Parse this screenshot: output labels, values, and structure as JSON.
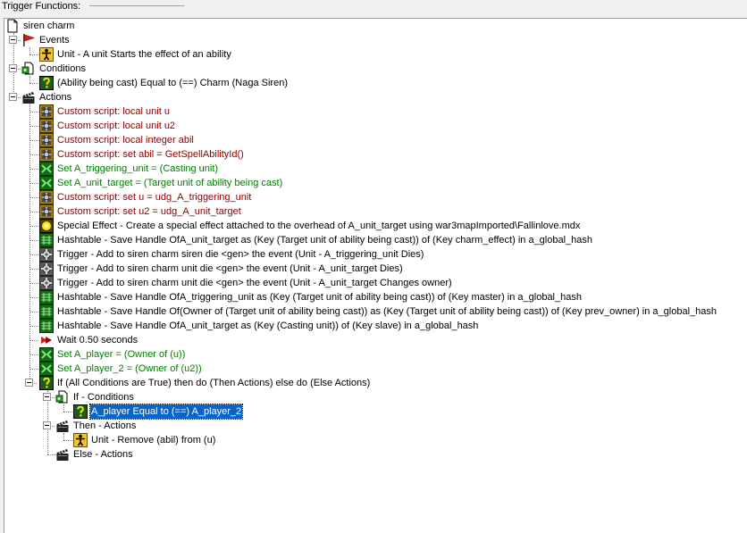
{
  "frame": {
    "title": "Trigger Functions:"
  },
  "colors": {
    "script_text": "#8b0000",
    "variable_text": "#008000",
    "selection_bg": "#0a64c8",
    "selection_text": "#ffffff"
  },
  "tree": {
    "root": {
      "label": "siren charm",
      "icon": "trigger-document-icon"
    },
    "events": {
      "label": "Events",
      "icon": "red-flag-icon",
      "items": [
        {
          "label": "Unit - A unit Starts the effect of an ability",
          "icon": "unit-figure-icon"
        }
      ]
    },
    "conditions": {
      "label": "Conditions",
      "icon": "conditions-icon",
      "items": [
        {
          "label": "(Ability being cast) Equal to (==) Charm (Naga Siren)",
          "icon": "question-mark-icon"
        }
      ]
    },
    "actions": {
      "label": "Actions",
      "icon": "clapperboard-icon",
      "items": [
        {
          "label": "Custom script:   local unit u",
          "icon": "custom-script-icon"
        },
        {
          "label": "Custom script:   local unit u2",
          "icon": "custom-script-icon"
        },
        {
          "label": "Custom script:   local integer abil",
          "icon": "custom-script-icon"
        },
        {
          "label": "Custom script:   set abil = GetSpellAbilityId()",
          "icon": "custom-script-icon"
        },
        {
          "label": "Set A_triggering_unit = (Casting unit)",
          "icon": "set-variable-icon"
        },
        {
          "label": "Set A_unit_target = (Target unit of ability being cast)",
          "icon": "set-variable-icon"
        },
        {
          "label": "Custom script:   set u = udg_A_triggering_unit",
          "icon": "custom-script-icon"
        },
        {
          "label": "Custom script:   set u2 = udg_A_unit_target",
          "icon": "custom-script-icon"
        },
        {
          "label": "Special Effect - Create a special effect attached to the overhead of A_unit_target using war3mapImported\\Fallinlove.mdx",
          "icon": "special-effect-icon"
        },
        {
          "label": "Hashtable - Save Handle OfA_unit_target as (Key (Target unit of ability being cast)) of (Key charm_effect) in a_global_hash",
          "icon": "hashtable-icon"
        },
        {
          "label": "Trigger - Add to siren charm siren die <gen> the event (Unit - A_triggering_unit Dies)",
          "icon": "trigger-gear-icon"
        },
        {
          "label": "Trigger - Add to siren charm unit die <gen> the event (Unit - A_unit_target Dies)",
          "icon": "trigger-gear-icon"
        },
        {
          "label": "Trigger - Add to siren charm unit die <gen> the event (Unit - A_unit_target Changes owner)",
          "icon": "trigger-gear-icon"
        },
        {
          "label": "Hashtable - Save Handle OfA_triggering_unit as (Key (Target unit of ability being cast)) of (Key master) in a_global_hash",
          "icon": "hashtable-icon"
        },
        {
          "label": "Hashtable - Save Handle Of(Owner of (Target unit of ability being cast)) as (Key (Target unit of ability being cast)) of (Key prev_owner) in a_global_hash",
          "icon": "hashtable-icon"
        },
        {
          "label": "Hashtable - Save Handle OfA_unit_target as (Key (Casting unit)) of (Key slave) in a_global_hash",
          "icon": "hashtable-icon"
        },
        {
          "label": "Wait 0.50 seconds",
          "icon": "wait-icon"
        },
        {
          "label": "Set A_player = (Owner of (u))",
          "icon": "set-variable-icon"
        },
        {
          "label": "Set A_player_2 = (Owner of (u2))",
          "icon": "set-variable-icon"
        }
      ],
      "if_block": {
        "label": "If (All Conditions are True) then do (Then Actions) else do (Else Actions)",
        "icon": "question-mark-icon",
        "if_conditions": {
          "label": "If - Conditions",
          "icon": "conditions-icon",
          "items": [
            {
              "label": "A_player Equal to (==) A_player_2",
              "icon": "question-mark-icon",
              "selected": true
            }
          ]
        },
        "then_actions": {
          "label": "Then - Actions",
          "icon": "clapperboard-icon",
          "items": [
            {
              "label": "Unit - Remove (abil) from (u)",
              "icon": "unit-figure-icon"
            }
          ]
        },
        "else_actions": {
          "label": "Else - Actions",
          "icon": "clapperboard-icon"
        }
      }
    }
  }
}
